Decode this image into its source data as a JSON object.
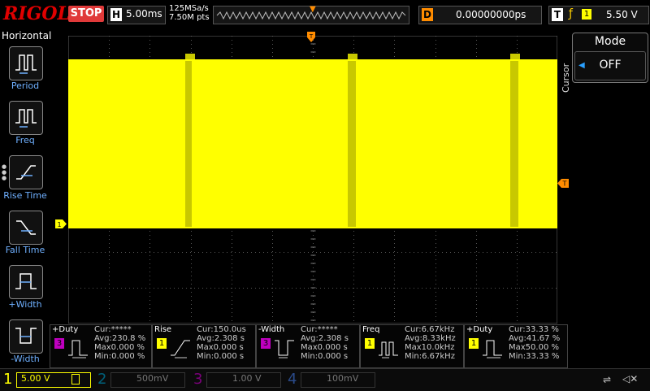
{
  "brand": "RIGOL",
  "run_state": "STOP",
  "horizontal": {
    "key": "H",
    "timebase": "5.00ms"
  },
  "acquisition": {
    "sample_rate": "125MSa/s",
    "points": "7.50M pts"
  },
  "delay": {
    "key": "D",
    "value": "0.00000000ps"
  },
  "trigger": {
    "key": "T",
    "channel": "1",
    "level": "5.50 V"
  },
  "left_menu": {
    "title": "Horizontal",
    "items": [
      {
        "label": "Period"
      },
      {
        "label": "Freq"
      },
      {
        "label": "Rise Time"
      },
      {
        "label": "Fall Time"
      },
      {
        "label": "+Width"
      },
      {
        "label": "-Width"
      }
    ]
  },
  "cursor_panel": {
    "side_label": "Cursor",
    "title": "Mode",
    "value": "OFF"
  },
  "channel1_marker": "1",
  "trigger_marker": "T",
  "measurements": [
    {
      "name": "+Duty",
      "channel": "3",
      "cur": "Cur:*****",
      "avg": "Avg:230.8 %",
      "max": "Max0.000 %",
      "min": "Min:0.000 %"
    },
    {
      "name": "Rise",
      "channel": "1",
      "cur": "Cur:150.0us",
      "avg": "Avg:2.308 s",
      "max": "Max0.000 s",
      "min": "Min:0.000 s"
    },
    {
      "name": "-Width",
      "channel": "3",
      "cur": "Cur:*****",
      "avg": "Avg:2.308 s",
      "max": "Max0.000 s",
      "min": "Min:0.000 s"
    },
    {
      "name": "Freq",
      "channel": "1",
      "cur": "Cur:6.67kHz",
      "avg": "Avg:8.33kHz",
      "max": "Max10.0kHz",
      "min": "Min:6.67kHz"
    },
    {
      "name": "+Duty",
      "channel": "1",
      "cur": "Cur:33.33 %",
      "avg": "Avg:41.67 %",
      "max": "Max50.00 %",
      "min": "Min:33.33 %"
    }
  ],
  "channels": [
    {
      "num": "1",
      "scale": "5.00 V",
      "color": "#ffff00"
    },
    {
      "num": "2",
      "scale": "500mV",
      "color": "#00c8ff"
    },
    {
      "num": "3",
      "scale": "1.00 V",
      "color": "#ff00ff"
    },
    {
      "num": "4",
      "scale": "100mV",
      "color": "#3a7bff"
    }
  ],
  "colors": {
    "ch1": "#ffff00",
    "ch3": "#c000c0",
    "trigger": "#ff8c00",
    "accent": "#6fb0ff"
  }
}
